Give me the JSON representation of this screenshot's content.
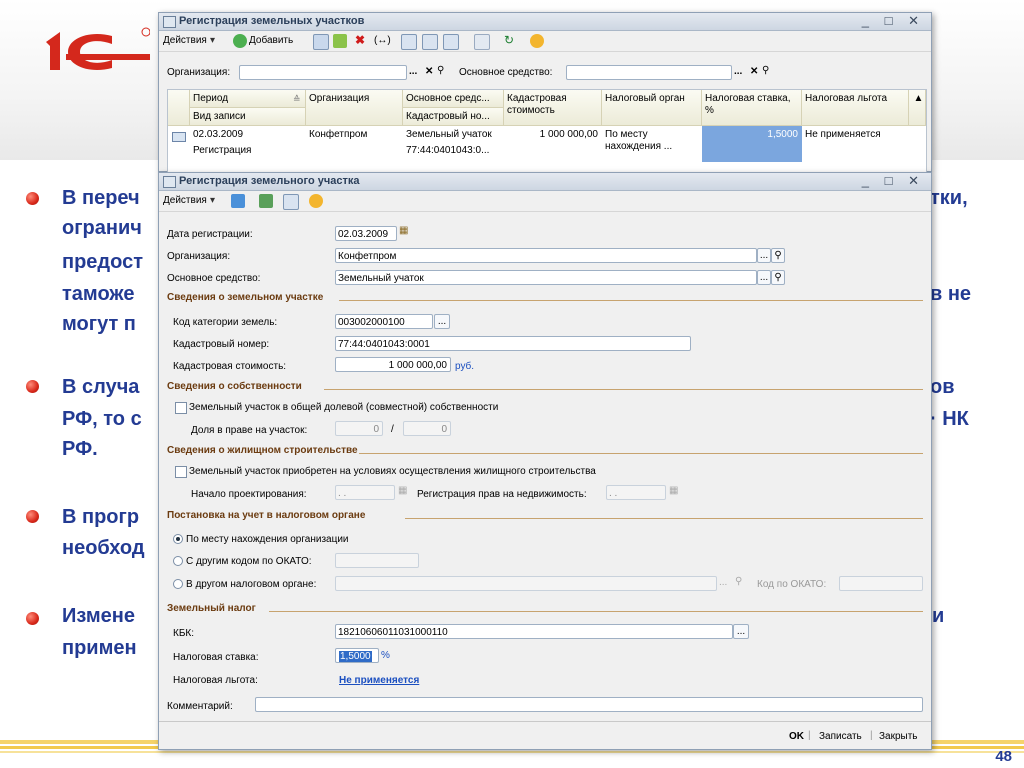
{
  "slide": {
    "bullets": [
      {
        "lines": [
          "В переч",
          "огранич",
          "предост",
          "таможе",
          "могут п"
        ],
        "right_lines": [
          "тки,",
          "",
          "",
          "в не",
          ""
        ]
      },
      {
        "lines": [
          "В случа",
          "РФ, то с",
          "РФ."
        ],
        "right_lines": [
          "ов",
          "· НК",
          ""
        ]
      },
      {
        "lines": [
          "В прогр",
          "необход"
        ],
        "right_lines": [
          "",
          ""
        ]
      },
      {
        "lines": [
          "Измене",
          "примен"
        ],
        "right_lines": [
          "и",
          ""
        ]
      }
    ],
    "page_number": "48",
    "colors": {
      "text": "#233b93",
      "bullet": "#d8281a",
      "logo": "#d4281c"
    }
  },
  "list_window": {
    "title": "Регистрация земельных участков",
    "toolbar": {
      "actions": "Действия",
      "add": "Добавить",
      "icons": [
        "copy-icon",
        "edit-icon",
        "delete-icon",
        "history-icon",
        "filter-icon",
        "filter-value-icon",
        "filter-list-icon",
        "clear-filter-icon",
        "refresh-icon",
        "help-icon"
      ]
    },
    "filters": {
      "org_label": "Организация:",
      "org_value": "",
      "asset_label": "Основное средство:",
      "asset_value": ""
    },
    "columns": [
      {
        "top": "Период",
        "bottom": "Вид записи"
      },
      {
        "top": "Организация",
        "bottom": ""
      },
      {
        "top": "Основное средс...",
        "bottom": "Кадастровый но..."
      },
      {
        "top": "Кадастровая стоимость",
        "bottom": ""
      },
      {
        "top": "Налоговый орган",
        "bottom": ""
      },
      {
        "top": "Налоговая ставка, %",
        "bottom": ""
      },
      {
        "top": "Налоговая льгота",
        "bottom": ""
      }
    ],
    "rows": [
      {
        "period": "02.03.2009",
        "kind": "Регистрация",
        "org": "Конфетпром",
        "asset": "Земельный учаток",
        "cadastral_no": "77:44:0401043:0...",
        "cadastral_value": "1 000 000,00",
        "tax_authority": "По месту нахождения ...",
        "tax_rate": "1,5000",
        "tax_relief": "Не применяется"
      }
    ]
  },
  "form_window": {
    "title": "Регистрация земельного участка",
    "toolbar": {
      "actions": "Действия"
    },
    "fields": {
      "reg_date_label": "Дата регистрации:",
      "reg_date": "02.03.2009",
      "org_label": "Организация:",
      "org": "Конфетпром",
      "asset_label": "Основное средство:",
      "asset": "Земельный учаток"
    },
    "land": {
      "section": "Сведения о земельном участке",
      "category_label": "Код категории земель:",
      "category": "003002000100",
      "cadastral_no_label": "Кадастровый номер:",
      "cadastral_no": "77:44:0401043:0001",
      "cadastral_value_label": "Кадастровая стоимость:",
      "cadastral_value": "1 000 000,00",
      "currency": "руб."
    },
    "ownership": {
      "section": "Сведения о собственности",
      "shared_label": "Земельный участок в общей долевой (совместной) собственности",
      "share_label": "Доля в праве на участок:",
      "share_num": "0",
      "slash": "/",
      "share_den": "0"
    },
    "housing": {
      "section": "Сведения о жилищном строительстве",
      "acquired_label": "Земельный участок приобретен на условиях осуществления жилищного строительства",
      "design_start_label": "Начало проектирования:",
      "design_start": " .  .",
      "rights_reg_label": "Регистрация прав на недвижимость:",
      "rights_reg": " .  ."
    },
    "tax_reg": {
      "section": "Постановка на учет в налоговом органе",
      "opt1": "По месту нахождения организации",
      "opt2": "С другим кодом по ОКАТО:",
      "opt2_value": "",
      "opt3": "В другом налоговом органе:",
      "opt3_value": "",
      "okato_label": "Код по ОКАТО:",
      "okato_value": ""
    },
    "land_tax": {
      "section": "Земельный налог",
      "kbk_label": "КБК:",
      "kbk": "18210606011031000110",
      "rate_label": "Налоговая ставка:",
      "rate": "1,5000",
      "rate_unit": "%",
      "relief_label": "Налоговая льгота:",
      "relief": "Не применяется"
    },
    "comment_label": "Комментарий:",
    "comment": "",
    "buttons": {
      "ok": "OK",
      "save": "Записать",
      "close": "Закрыть"
    }
  }
}
